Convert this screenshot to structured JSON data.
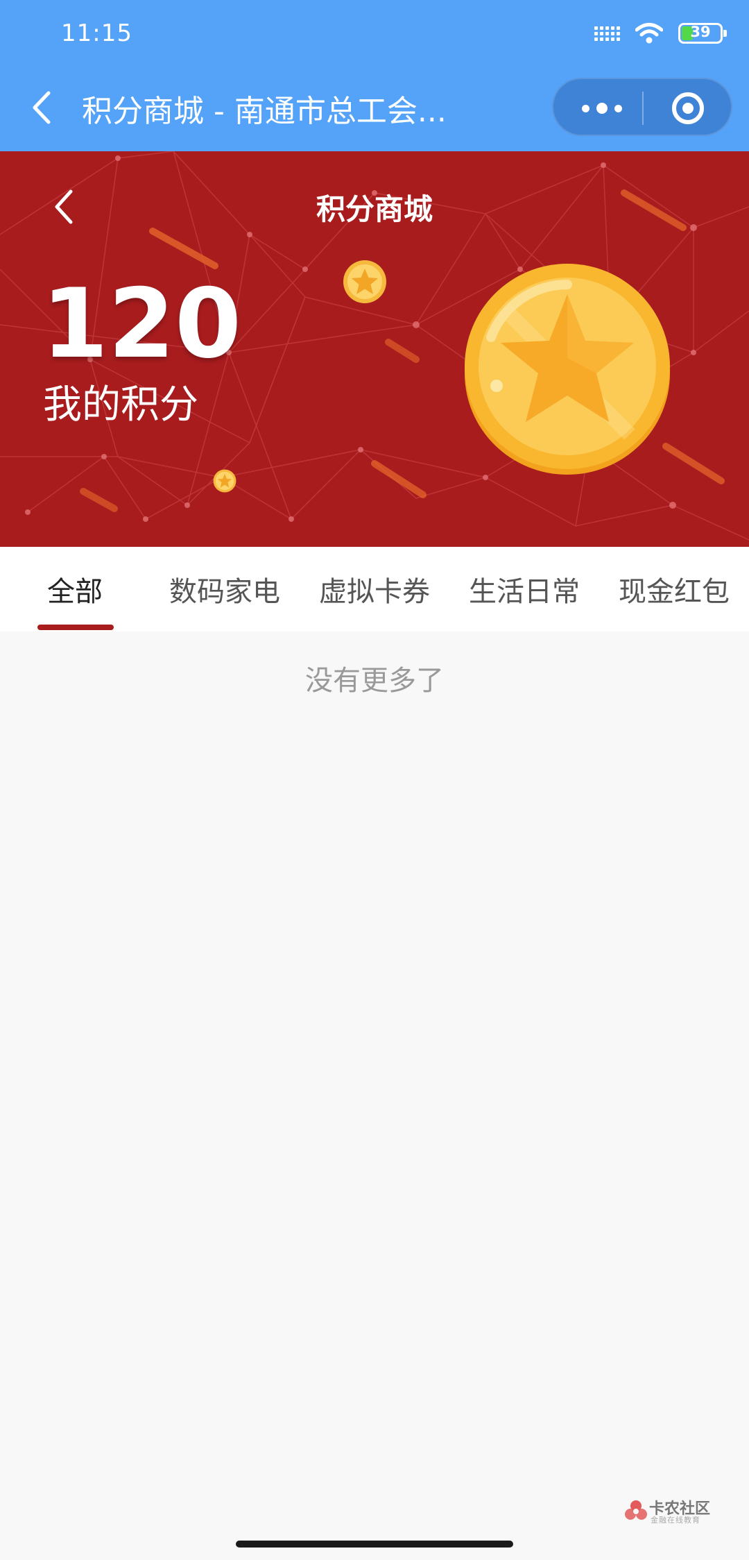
{
  "status_bar": {
    "time": "11:15",
    "battery_level": "39",
    "icons": [
      "signal-icon",
      "wifi-icon",
      "battery-icon"
    ]
  },
  "nav": {
    "title": "积分商城 - 南通市总工会...",
    "back_icon": "chevron-left-icon",
    "more_icon": "more-dots-icon",
    "close_icon": "target-close-icon"
  },
  "banner": {
    "title": "积分商城",
    "points_value": "120",
    "points_label": "我的积分",
    "back_icon": "chevron-left-icon",
    "coin_icon": "star-coin-icon"
  },
  "tabs": [
    {
      "label": "全部",
      "active": true
    },
    {
      "label": "数码家电",
      "active": false
    },
    {
      "label": "虚拟卡券",
      "active": false
    },
    {
      "label": "生活日常",
      "active": false
    },
    {
      "label": "现金红包",
      "active": false
    }
  ],
  "content": {
    "empty_message": "没有更多了"
  },
  "watermark": {
    "name": "卡农社区",
    "subtitle": "金融在线教育"
  },
  "colors": {
    "nav_blue": "#55a3f8",
    "capsule_blue": "#3f83d6",
    "banner_red": "#a81c1e",
    "coin_gold": "#f6b63a",
    "tab_indicator": "#a81c1e",
    "page_bg": "#f8f8f8"
  }
}
